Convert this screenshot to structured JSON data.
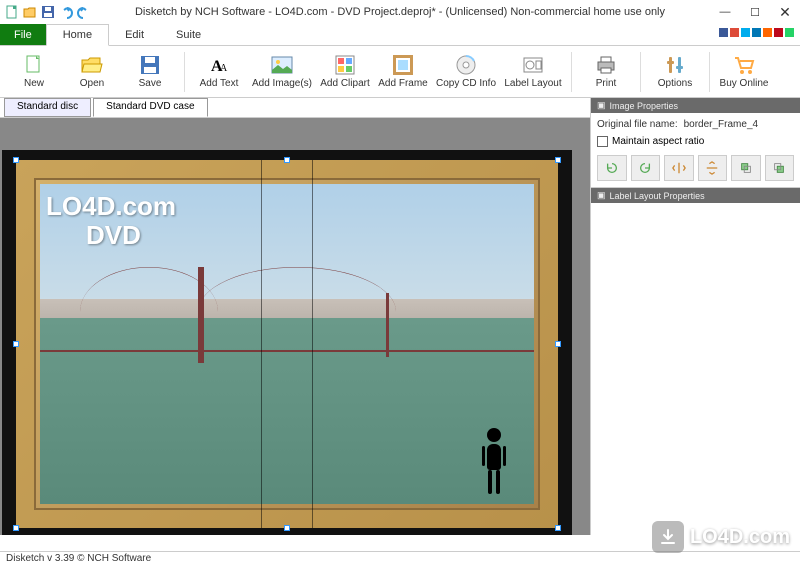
{
  "window": {
    "title": "Disketch by NCH Software - LO4D.com - DVD Project.deproj* - (Unlicensed) Non-commercial home use only"
  },
  "menu": {
    "file": "File",
    "tabs": [
      "Home",
      "Edit",
      "Suite"
    ],
    "active_tab": "Home"
  },
  "ribbon": {
    "new": "New",
    "open": "Open",
    "save": "Save",
    "add_text": "Add Text",
    "add_images": "Add Image(s)",
    "add_clipart": "Add Clipart",
    "add_frame": "Add Frame",
    "copy_cd_info": "Copy CD Info",
    "label_layout": "Label Layout",
    "print": "Print",
    "options": "Options",
    "buy_online": "Buy Online"
  },
  "doc_tabs": {
    "items": [
      "Standard disc",
      "Standard DVD case"
    ],
    "active": 1
  },
  "canvas": {
    "overlay_line1": "LO4D.com",
    "overlay_line2": "DVD"
  },
  "panels": {
    "image_props": {
      "title": "Image Properties",
      "filename_label": "Original file name:",
      "filename_value": "border_Frame_4",
      "maintain_aspect": "Maintain aspect ratio"
    },
    "label_layout_props": {
      "title": "Label Layout Properties"
    }
  },
  "statusbar": {
    "text": "Disketch v 3.39   © NCH Software"
  },
  "watermark": {
    "text": "LO4D.com"
  },
  "social_colors": [
    "#3b5998",
    "#dd4b39",
    "#00aced",
    "#0077b5",
    "#ff6600",
    "#bd081c",
    "#25d366"
  ]
}
